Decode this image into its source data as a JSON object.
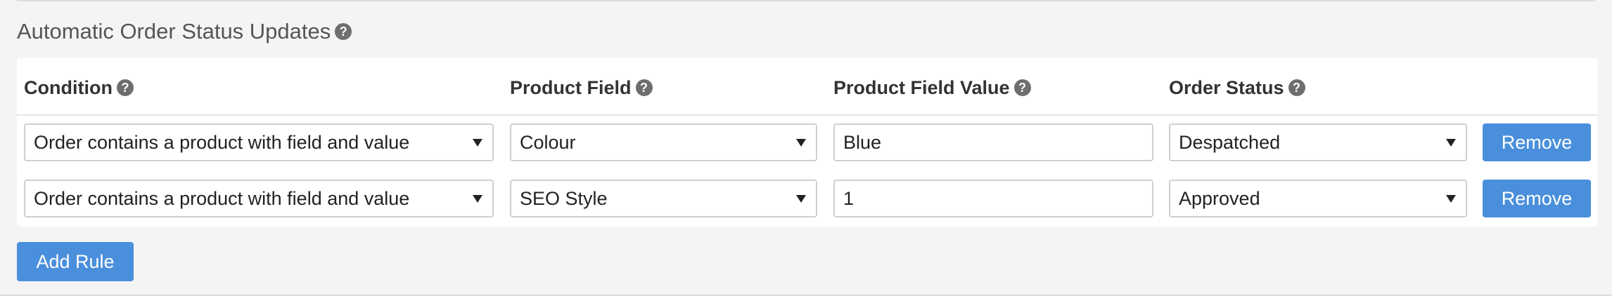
{
  "section": {
    "title": "Automatic Order Status Updates",
    "help_glyph": "?"
  },
  "table": {
    "headers": {
      "condition": "Condition",
      "product_field": "Product Field",
      "product_field_value": "Product Field Value",
      "order_status": "Order Status"
    },
    "rows": [
      {
        "condition": "Order contains a product with field and value",
        "product_field": "Colour",
        "product_field_value": "Blue",
        "order_status": "Despatched",
        "remove_label": "Remove"
      },
      {
        "condition": "Order contains a product with field and value",
        "product_field": "SEO Style",
        "product_field_value": "1",
        "order_status": "Approved",
        "remove_label": "Remove"
      }
    ]
  },
  "actions": {
    "add_rule_label": "Add Rule"
  },
  "icons": {
    "help": "question-circle-icon",
    "dropdown": "caret-down-icon"
  },
  "colors": {
    "primary_button": "#4a8fdc",
    "background": "#f4f4f4",
    "panel": "#ffffff"
  }
}
